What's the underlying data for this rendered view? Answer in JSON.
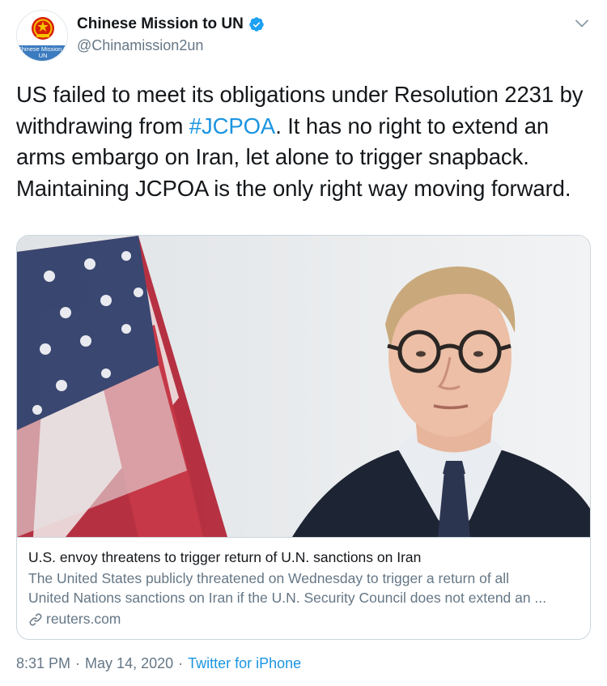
{
  "author": {
    "display_name": "Chinese Mission to UN",
    "handle": "@Chinamission2un",
    "avatar_text": "Chinese Mission to UN",
    "verified": true
  },
  "tweet": {
    "text_parts": [
      "US failed to meet its obligations under Resolution 2231 by withdrawing from ",
      "#JCPOA",
      ". It has no right to extend an arms embargo on Iran, let alone to trigger snapback. Maintaining JCPOA is the only right way moving forward."
    ]
  },
  "card": {
    "title": "U.S. envoy threatens to trigger return of U.N. sanctions on Iran",
    "description_line1": "The United States publicly threatened on Wednesday to trigger a return of all",
    "description_line2": "United Nations sanctions on Iran if the U.N. Security Council does not extend an ...",
    "domain": "reuters.com"
  },
  "meta": {
    "time": "8:31 PM",
    "separator": "·",
    "date": "May 14, 2020",
    "source": "Twitter for iPhone"
  },
  "colors": {
    "accent": "#1b95e0",
    "secondary_text": "#657786",
    "border": "#ccd6dd"
  },
  "icons": {
    "verified": "verified-badge-icon",
    "menu": "chevron-down-icon",
    "link": "link-icon"
  }
}
